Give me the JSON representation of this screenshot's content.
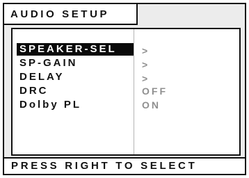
{
  "title": "AUDIO SETUP",
  "menu": {
    "items": [
      {
        "label": "SPEAKER-SEL",
        "value": ">"
      },
      {
        "label": "SP-GAIN",
        "value": ">"
      },
      {
        "label": "DELAY",
        "value": ">"
      },
      {
        "label": "DRC",
        "value": "OFF"
      },
      {
        "label": "Dolby PL",
        "value": "ON"
      }
    ],
    "selected": "SPEAKER-SEL"
  },
  "status": "PRESS RIGHT TO SELECT",
  "colors": {
    "selection_bg": "#0a0a0a",
    "frame_bg": "#ececec",
    "value_text": "#8f8f8f"
  }
}
